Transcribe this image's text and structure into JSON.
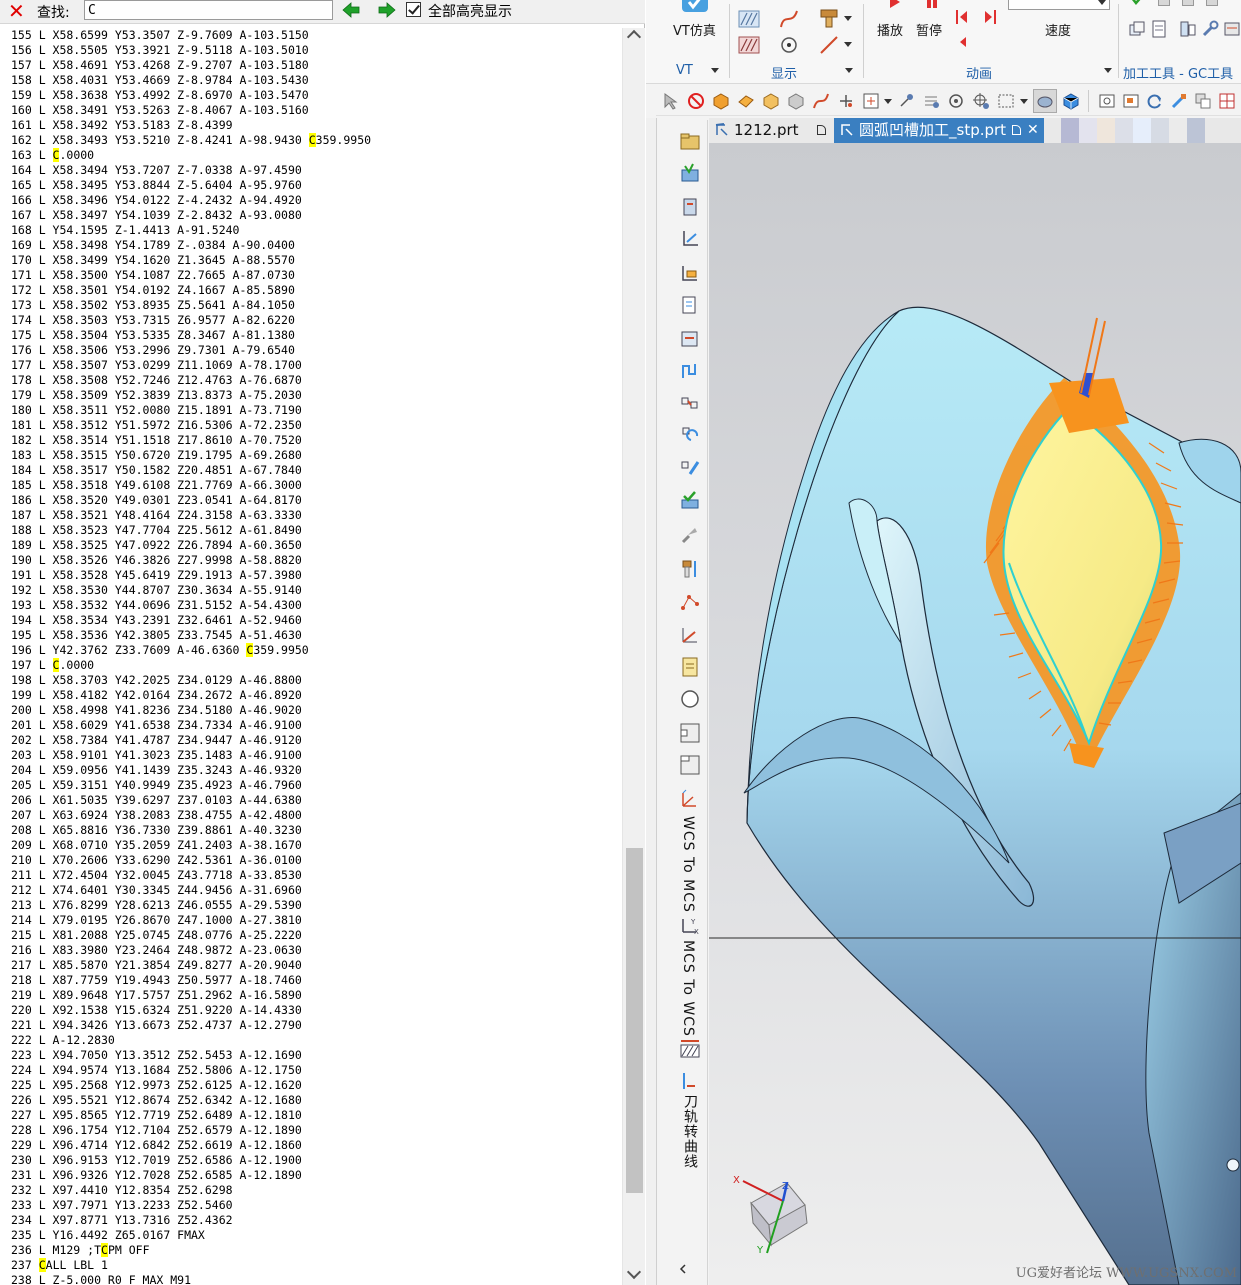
{
  "find_bar": {
    "label": "查找:",
    "query": "C",
    "highlight_all_label": "全部高亮显示",
    "highlight_all_checked": true
  },
  "code_lines": [
    [
      {
        "t": "155 L X58.6599 Y53.3507 Z-9.7609 A-103.5150"
      }
    ],
    [
      {
        "t": "156 L X58.5505 Y53.3921 Z-9.5118 A-103.5010"
      }
    ],
    [
      {
        "t": "157 L X58.4691 Y53.4268 Z-9.2707 A-103.5180"
      }
    ],
    [
      {
        "t": "158 L X58.4031 Y53.4669 Z-8.9784 A-103.5430"
      }
    ],
    [
      {
        "t": "159 L X58.3638 Y53.4992 Z-8.6970 A-103.5470"
      }
    ],
    [
      {
        "t": "160 L X58.3491 Y53.5263 Z-8.4067 A-103.5160"
      }
    ],
    [
      {
        "t": "161 L X58.3492 Y53.5183 Z-8.4399"
      }
    ],
    [
      {
        "t": "162 L X58.3493 Y53.5210 Z-8.4241 A-98.9430 "
      },
      {
        "t": "C",
        "h": 1
      },
      {
        "t": "359.9950"
      }
    ],
    [
      {
        "t": "163 L "
      },
      {
        "t": "C",
        "h": 1
      },
      {
        "t": ".0000"
      }
    ],
    [
      {
        "t": "164 L X58.3494 Y53.7207 Z-7.0338 A-97.4590"
      }
    ],
    [
      {
        "t": "165 L X58.3495 Y53.8844 Z-5.6404 A-95.9760"
      }
    ],
    [
      {
        "t": "166 L X58.3496 Y54.0122 Z-4.2432 A-94.4920"
      }
    ],
    [
      {
        "t": "167 L X58.3497 Y54.1039 Z-2.8432 A-93.0080"
      }
    ],
    [
      {
        "t": "168 L Y54.1595 Z-1.4413 A-91.5240"
      }
    ],
    [
      {
        "t": "169 L X58.3498 Y54.1789 Z-.0384 A-90.0400"
      }
    ],
    [
      {
        "t": "170 L X58.3499 Y54.1620 Z1.3645 A-88.5570"
      }
    ],
    [
      {
        "t": "171 L X58.3500 Y54.1087 Z2.7665 A-87.0730"
      }
    ],
    [
      {
        "t": "172 L X58.3501 Y54.0192 Z4.1667 A-85.5890"
      }
    ],
    [
      {
        "t": "173 L X58.3502 Y53.8935 Z5.5641 A-84.1050"
      }
    ],
    [
      {
        "t": "174 L X58.3503 Y53.7315 Z6.9577 A-82.6220"
      }
    ],
    [
      {
        "t": "175 L X58.3504 Y53.5335 Z8.3467 A-81.1380"
      }
    ],
    [
      {
        "t": "176 L X58.3506 Y53.2996 Z9.7301 A-79.6540"
      }
    ],
    [
      {
        "t": "177 L X58.3507 Y53.0299 Z11.1069 A-78.1700"
      }
    ],
    [
      {
        "t": "178 L X58.3508 Y52.7246 Z12.4763 A-76.6870"
      }
    ],
    [
      {
        "t": "179 L X58.3509 Y52.3839 Z13.8373 A-75.2030"
      }
    ],
    [
      {
        "t": "180 L X58.3511 Y52.0080 Z15.1891 A-73.7190"
      }
    ],
    [
      {
        "t": "181 L X58.3512 Y51.5972 Z16.5306 A-72.2350"
      }
    ],
    [
      {
        "t": "182 L X58.3514 Y51.1518 Z17.8610 A-70.7520"
      }
    ],
    [
      {
        "t": "183 L X58.3515 Y50.6720 Z19.1795 A-69.2680"
      }
    ],
    [
      {
        "t": "184 L X58.3517 Y50.1582 Z20.4851 A-67.7840"
      }
    ],
    [
      {
        "t": "185 L X58.3518 Y49.6108 Z21.7769 A-66.3000"
      }
    ],
    [
      {
        "t": "186 L X58.3520 Y49.0301 Z23.0541 A-64.8170"
      }
    ],
    [
      {
        "t": "187 L X58.3521 Y48.4164 Z24.3158 A-63.3330"
      }
    ],
    [
      {
        "t": "188 L X58.3523 Y47.7704 Z25.5612 A-61.8490"
      }
    ],
    [
      {
        "t": "189 L X58.3525 Y47.0922 Z26.7894 A-60.3650"
      }
    ],
    [
      {
        "t": "190 L X58.3526 Y46.3826 Z27.9998 A-58.8820"
      }
    ],
    [
      {
        "t": "191 L X58.3528 Y45.6419 Z29.1913 A-57.3980"
      }
    ],
    [
      {
        "t": "192 L X58.3530 Y44.8707 Z30.3634 A-55.9140"
      }
    ],
    [
      {
        "t": "193 L X58.3532 Y44.0696 Z31.5152 A-54.4300"
      }
    ],
    [
      {
        "t": "194 L X58.3534 Y43.2391 Z32.6461 A-52.9460"
      }
    ],
    [
      {
        "t": "195 L X58.3536 Y42.3805 Z33.7545 A-51.4630"
      }
    ],
    [
      {
        "t": "196 L Y42.3762 Z33.7609 A-46.6360 "
      },
      {
        "t": "C",
        "h": 1
      },
      {
        "t": "359.9950"
      }
    ],
    [
      {
        "t": "197 L "
      },
      {
        "t": "C",
        "h": 1
      },
      {
        "t": ".0000"
      }
    ],
    [
      {
        "t": "198 L X58.3703 Y42.2025 Z34.0129 A-46.8800"
      }
    ],
    [
      {
        "t": "199 L X58.4182 Y42.0164 Z34.2672 A-46.8920"
      }
    ],
    [
      {
        "t": "200 L X58.4998 Y41.8236 Z34.5180 A-46.9020"
      }
    ],
    [
      {
        "t": "201 L X58.6029 Y41.6538 Z34.7334 A-46.9100"
      }
    ],
    [
      {
        "t": "202 L X58.7384 Y41.4787 Z34.9447 A-46.9120"
      }
    ],
    [
      {
        "t": "203 L X58.9101 Y41.3023 Z35.1483 A-46.9100"
      }
    ],
    [
      {
        "t": "204 L X59.0956 Y41.1439 Z35.3243 A-46.9320"
      }
    ],
    [
      {
        "t": "205 L X59.3151 Y40.9949 Z35.4923 A-46.7960"
      }
    ],
    [
      {
        "t": "206 L X61.5035 Y39.6297 Z37.0103 A-44.6380"
      }
    ],
    [
      {
        "t": "207 L X63.6924 Y38.2083 Z38.4755 A-42.4800"
      }
    ],
    [
      {
        "t": "208 L X65.8816 Y36.7330 Z39.8861 A-40.3230"
      }
    ],
    [
      {
        "t": "209 L X68.0710 Y35.2059 Z41.2403 A-38.1670"
      }
    ],
    [
      {
        "t": "210 L X70.2606 Y33.6290 Z42.5361 A-36.0100"
      }
    ],
    [
      {
        "t": "211 L X72.4504 Y32.0045 Z43.7718 A-33.8530"
      }
    ],
    [
      {
        "t": "212 L X74.6401 Y30.3345 Z44.9456 A-31.6960"
      }
    ],
    [
      {
        "t": "213 L X76.8299 Y28.6213 Z46.0555 A-29.5390"
      }
    ],
    [
      {
        "t": "214 L X79.0195 Y26.8670 Z47.1000 A-27.3810"
      }
    ],
    [
      {
        "t": "215 L X81.2088 Y25.0745 Z48.0776 A-25.2220"
      }
    ],
    [
      {
        "t": "216 L X83.3980 Y23.2464 Z48.9872 A-23.0630"
      }
    ],
    [
      {
        "t": "217 L X85.5870 Y21.3854 Z49.8277 A-20.9040"
      }
    ],
    [
      {
        "t": "218 L X87.7759 Y19.4943 Z50.5977 A-18.7460"
      }
    ],
    [
      {
        "t": "219 L X89.9648 Y17.5757 Z51.2962 A-16.5890"
      }
    ],
    [
      {
        "t": "220 L X92.1538 Y15.6324 Z51.9220 A-14.4330"
      }
    ],
    [
      {
        "t": "221 L X94.3426 Y13.6673 Z52.4737 A-12.2790"
      }
    ],
    [
      {
        "t": "222 L A-12.2830"
      }
    ],
    [
      {
        "t": "223 L X94.7050 Y13.3512 Z52.5453 A-12.1690"
      }
    ],
    [
      {
        "t": "224 L X94.9574 Y13.1684 Z52.5806 A-12.1750"
      }
    ],
    [
      {
        "t": "225 L X95.2568 Y12.9973 Z52.6125 A-12.1620"
      }
    ],
    [
      {
        "t": "226 L X95.5521 Y12.8674 Z52.6342 A-12.1680"
      }
    ],
    [
      {
        "t": "227 L X95.8565 Y12.7719 Z52.6489 A-12.1810"
      }
    ],
    [
      {
        "t": "228 L X96.1754 Y12.7104 Z52.6579 A-12.1890"
      }
    ],
    [
      {
        "t": "229 L X96.4714 Y12.6842 Z52.6619 A-12.1860"
      }
    ],
    [
      {
        "t": "230 L X96.9153 Y12.7019 Z52.6586 A-12.1900"
      }
    ],
    [
      {
        "t": "231 L X96.9326 Y12.7028 Z52.6585 A-12.1890"
      }
    ],
    [
      {
        "t": "232 L X97.4410 Y12.8354 Z52.6298"
      }
    ],
    [
      {
        "t": "233 L X97.7971 Y13.2233 Z52.5460"
      }
    ],
    [
      {
        "t": "234 L X97.8771 Y13.7316 Z52.4362"
      }
    ],
    [
      {
        "t": "235 L Y16.4492 Z65.0167 FMAX"
      }
    ],
    [
      {
        "t": "236 L M129 ;T"
      },
      {
        "t": "C",
        "h": 1
      },
      {
        "t": "PM OFF"
      }
    ],
    [
      {
        "t": "237 "
      },
      {
        "t": "C",
        "h": 1
      },
      {
        "t": "ALL LBL 1"
      }
    ],
    [
      {
        "t": "238 L Z-5.000 R0 F MAX M91"
      }
    ]
  ],
  "ribbon": {
    "vt_sim_label": "VT仿真",
    "group_vt": "VT",
    "group_display": "显示",
    "play_label": "播放",
    "pause_label": "暂停",
    "speed_label": "速度",
    "group_animation": "动画",
    "group_tools": "加工工具 - GC工具"
  },
  "tabs": [
    {
      "label": "1212.prt"
    },
    {
      "label": "圆弧凹槽加工_stp.prt"
    }
  ],
  "sidebar": {
    "wcs_to_mcs": "WCS To MCS",
    "mcs_to_wcs": "MCS To WCS",
    "toolpath_to_curve": "刀轨转曲线"
  },
  "triad": {
    "x": "X",
    "y": "Y",
    "z": "Z"
  },
  "watermark": "UG爱好者论坛 WWW.UGSNX.COM",
  "colors": {
    "highlight": "#ffff00",
    "tab_active": "#3a7fc1",
    "part_blue": "#aee6f2",
    "toolpath_orange": "#f5923a",
    "pocket_yellow": "#fff59a",
    "find_close": "#e00000",
    "nav_arrow": "#1fa12a"
  }
}
